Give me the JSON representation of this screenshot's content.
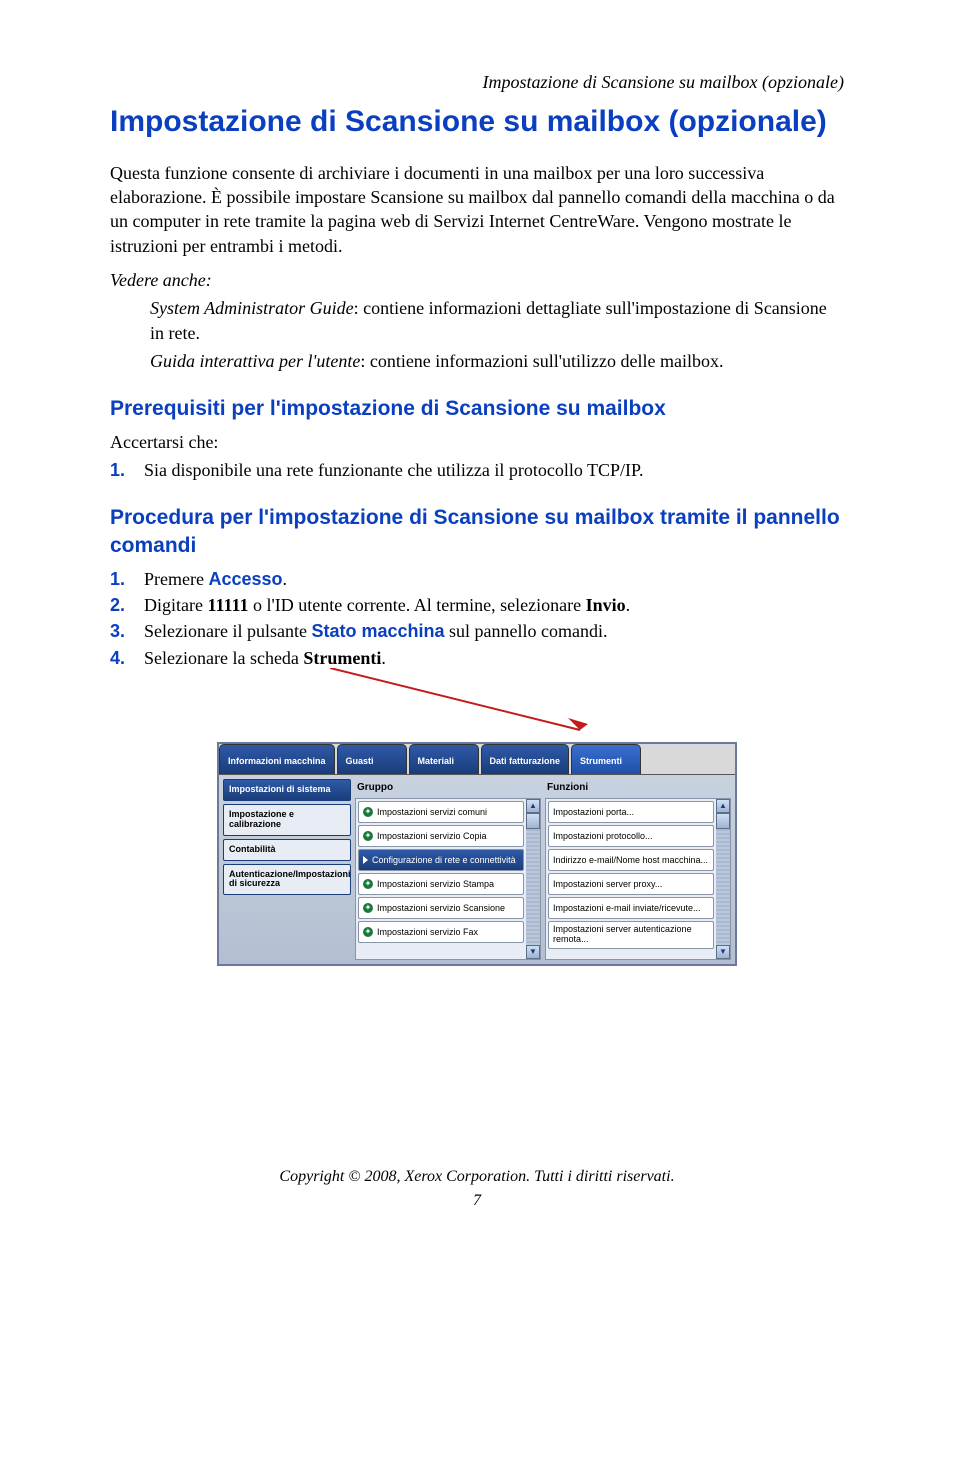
{
  "running_header": "Impostazione di Scansione su mailbox (opzionale)",
  "title": "Impostazione di Scansione su mailbox (opzionale)",
  "intro": "Questa funzione consente di archiviare i documenti in una mailbox per una loro successiva elaborazione. È possibile impostare Scansione su mailbox dal pannello comandi della macchina o da un computer in rete tramite la pagina web di Servizi Internet CentreWare. Vengono mostrate le istruzioni per entrambi i metodi.",
  "see_also": {
    "label": "Vedere anche:",
    "items": [
      {
        "title": "System Administrator Guide",
        "desc": ": contiene informazioni dettagliate sull'impostazione di Scansione in rete."
      },
      {
        "title": "Guida interattiva per l'utente",
        "desc": ": contiene informazioni sull'utilizzo delle mailbox."
      }
    ]
  },
  "h2_prereq": "Prerequisiti per l'impostazione di Scansione su mailbox",
  "prereq_intro": "Accertarsi che:",
  "prereq_steps": [
    "Sia disponibile una rete funzionante che utilizza il protocollo TCP/IP."
  ],
  "h2_proc": "Procedura per l'impostazione di Scansione su mailbox tramite il pannello comandi",
  "proc_steps": [
    {
      "pre": "Premere ",
      "kw": "Accesso",
      "post": "."
    },
    {
      "pre": "Digitare ",
      "bold1": "11111",
      "mid": " o l'ID utente corrente. Al termine, selezionare ",
      "bold2": "Invio",
      "post": "."
    },
    {
      "pre": "Selezionare il pulsante ",
      "kw": "Stato macchina",
      "post": " sul pannello comandi."
    },
    {
      "pre": "Selezionare la scheda ",
      "bold1": "Strumenti",
      "post": "."
    }
  ],
  "ui": {
    "tabs": [
      "Informazioni macchina",
      "Guasti",
      "Materiali",
      "Dati fatturazione",
      "Strumenti"
    ],
    "sidebar": [
      "Impostazioni di sistema",
      "Impostazione e calibrazione",
      "Contabilità",
      "Autenticazione/Impostazioni di sicurezza"
    ],
    "col1_header": "Gruppo",
    "col1_items": [
      "Impostazioni servizi comuni",
      "Impostazioni servizio Copia",
      "Configurazione di rete e connettività",
      "Impostazioni servizio Stampa",
      "Impostazioni servizio Scansione",
      "Impostazioni servizio Fax"
    ],
    "col2_header": "Funzioni",
    "col2_items": [
      "Impostazioni porta...",
      "Impostazioni protocollo...",
      "Indirizzo e-mail/Nome host macchina...",
      "Impostazioni server proxy...",
      "Impostazioni e-mail inviate/ricevute...",
      "Impostazioni server autenticazione remota..."
    ]
  },
  "footer": "Copyright © 2008, Xerox Corporation. Tutti i diritti riservati.",
  "page_num": "7"
}
